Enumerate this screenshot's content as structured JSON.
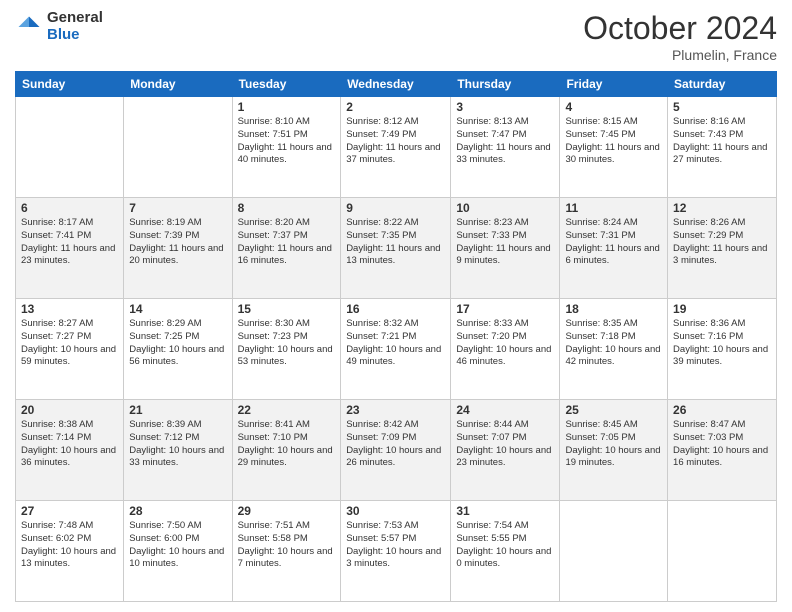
{
  "logo": {
    "general": "General",
    "blue": "Blue"
  },
  "header": {
    "month": "October 2024",
    "location": "Plumelin, France"
  },
  "weekdays": [
    "Sunday",
    "Monday",
    "Tuesday",
    "Wednesday",
    "Thursday",
    "Friday",
    "Saturday"
  ],
  "weeks": [
    [
      {
        "day": "",
        "info": ""
      },
      {
        "day": "",
        "info": ""
      },
      {
        "day": "1",
        "info": "Sunrise: 8:10 AM\nSunset: 7:51 PM\nDaylight: 11 hours and 40 minutes."
      },
      {
        "day": "2",
        "info": "Sunrise: 8:12 AM\nSunset: 7:49 PM\nDaylight: 11 hours and 37 minutes."
      },
      {
        "day": "3",
        "info": "Sunrise: 8:13 AM\nSunset: 7:47 PM\nDaylight: 11 hours and 33 minutes."
      },
      {
        "day": "4",
        "info": "Sunrise: 8:15 AM\nSunset: 7:45 PM\nDaylight: 11 hours and 30 minutes."
      },
      {
        "day": "5",
        "info": "Sunrise: 8:16 AM\nSunset: 7:43 PM\nDaylight: 11 hours and 27 minutes."
      }
    ],
    [
      {
        "day": "6",
        "info": "Sunrise: 8:17 AM\nSunset: 7:41 PM\nDaylight: 11 hours and 23 minutes."
      },
      {
        "day": "7",
        "info": "Sunrise: 8:19 AM\nSunset: 7:39 PM\nDaylight: 11 hours and 20 minutes."
      },
      {
        "day": "8",
        "info": "Sunrise: 8:20 AM\nSunset: 7:37 PM\nDaylight: 11 hours and 16 minutes."
      },
      {
        "day": "9",
        "info": "Sunrise: 8:22 AM\nSunset: 7:35 PM\nDaylight: 11 hours and 13 minutes."
      },
      {
        "day": "10",
        "info": "Sunrise: 8:23 AM\nSunset: 7:33 PM\nDaylight: 11 hours and 9 minutes."
      },
      {
        "day": "11",
        "info": "Sunrise: 8:24 AM\nSunset: 7:31 PM\nDaylight: 11 hours and 6 minutes."
      },
      {
        "day": "12",
        "info": "Sunrise: 8:26 AM\nSunset: 7:29 PM\nDaylight: 11 hours and 3 minutes."
      }
    ],
    [
      {
        "day": "13",
        "info": "Sunrise: 8:27 AM\nSunset: 7:27 PM\nDaylight: 10 hours and 59 minutes."
      },
      {
        "day": "14",
        "info": "Sunrise: 8:29 AM\nSunset: 7:25 PM\nDaylight: 10 hours and 56 minutes."
      },
      {
        "day": "15",
        "info": "Sunrise: 8:30 AM\nSunset: 7:23 PM\nDaylight: 10 hours and 53 minutes."
      },
      {
        "day": "16",
        "info": "Sunrise: 8:32 AM\nSunset: 7:21 PM\nDaylight: 10 hours and 49 minutes."
      },
      {
        "day": "17",
        "info": "Sunrise: 8:33 AM\nSunset: 7:20 PM\nDaylight: 10 hours and 46 minutes."
      },
      {
        "day": "18",
        "info": "Sunrise: 8:35 AM\nSunset: 7:18 PM\nDaylight: 10 hours and 42 minutes."
      },
      {
        "day": "19",
        "info": "Sunrise: 8:36 AM\nSunset: 7:16 PM\nDaylight: 10 hours and 39 minutes."
      }
    ],
    [
      {
        "day": "20",
        "info": "Sunrise: 8:38 AM\nSunset: 7:14 PM\nDaylight: 10 hours and 36 minutes."
      },
      {
        "day": "21",
        "info": "Sunrise: 8:39 AM\nSunset: 7:12 PM\nDaylight: 10 hours and 33 minutes."
      },
      {
        "day": "22",
        "info": "Sunrise: 8:41 AM\nSunset: 7:10 PM\nDaylight: 10 hours and 29 minutes."
      },
      {
        "day": "23",
        "info": "Sunrise: 8:42 AM\nSunset: 7:09 PM\nDaylight: 10 hours and 26 minutes."
      },
      {
        "day": "24",
        "info": "Sunrise: 8:44 AM\nSunset: 7:07 PM\nDaylight: 10 hours and 23 minutes."
      },
      {
        "day": "25",
        "info": "Sunrise: 8:45 AM\nSunset: 7:05 PM\nDaylight: 10 hours and 19 minutes."
      },
      {
        "day": "26",
        "info": "Sunrise: 8:47 AM\nSunset: 7:03 PM\nDaylight: 10 hours and 16 minutes."
      }
    ],
    [
      {
        "day": "27",
        "info": "Sunrise: 7:48 AM\nSunset: 6:02 PM\nDaylight: 10 hours and 13 minutes."
      },
      {
        "day": "28",
        "info": "Sunrise: 7:50 AM\nSunset: 6:00 PM\nDaylight: 10 hours and 10 minutes."
      },
      {
        "day": "29",
        "info": "Sunrise: 7:51 AM\nSunset: 5:58 PM\nDaylight: 10 hours and 7 minutes."
      },
      {
        "day": "30",
        "info": "Sunrise: 7:53 AM\nSunset: 5:57 PM\nDaylight: 10 hours and 3 minutes."
      },
      {
        "day": "31",
        "info": "Sunrise: 7:54 AM\nSunset: 5:55 PM\nDaylight: 10 hours and 0 minutes."
      },
      {
        "day": "",
        "info": ""
      },
      {
        "day": "",
        "info": ""
      }
    ]
  ]
}
